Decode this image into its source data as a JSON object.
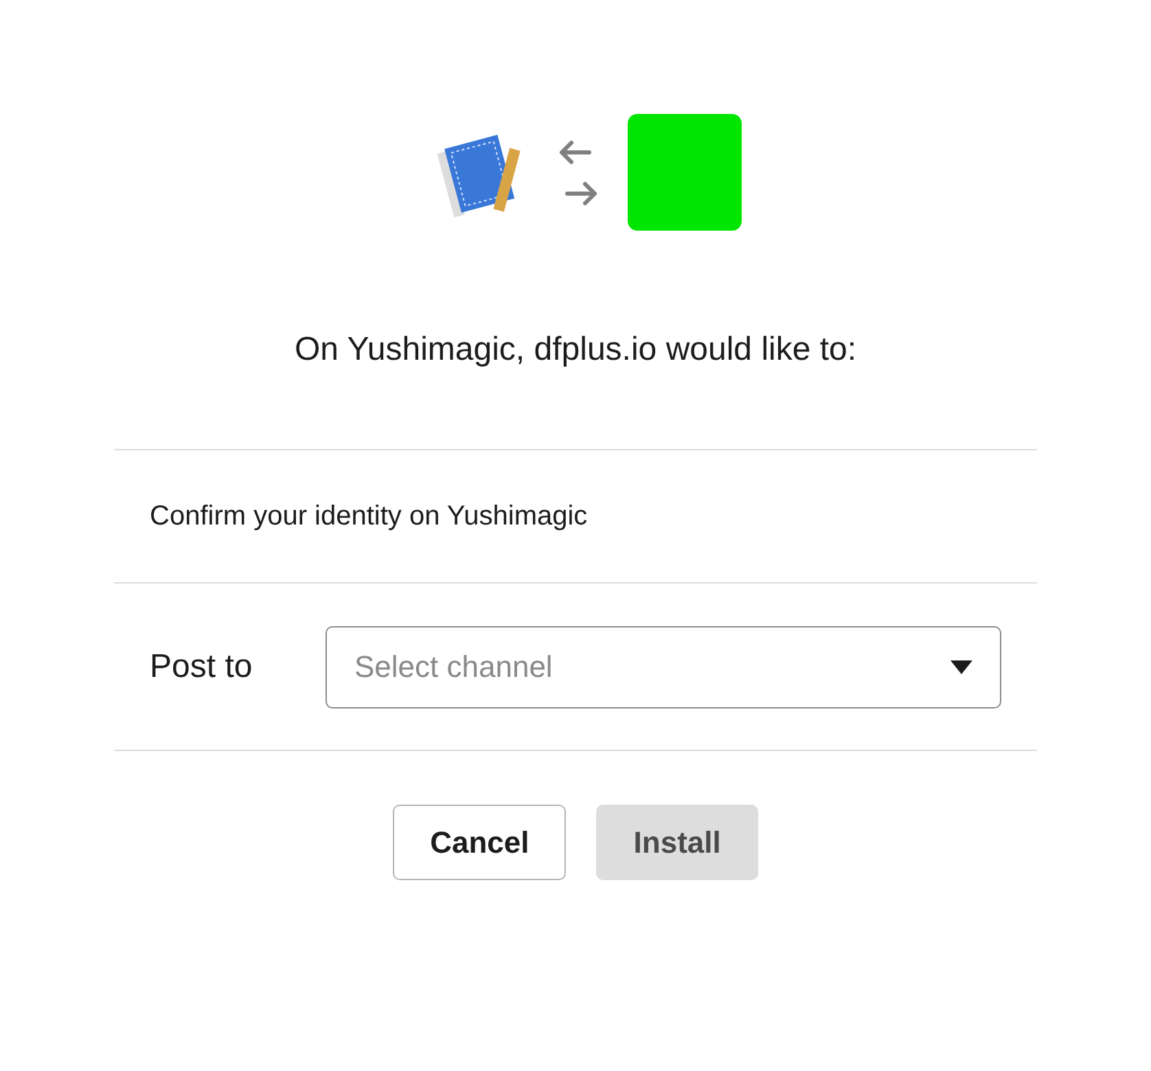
{
  "heading": "On Yushimagic, dfplus.io would like to:",
  "permissions": [
    {
      "text": "Confirm your identity on Yushimagic"
    }
  ],
  "post_to": {
    "label": "Post to",
    "placeholder": "Select channel"
  },
  "buttons": [
    {
      "label": "Cancel",
      "disabled": false
    },
    {
      "label": "Install",
      "disabled": true
    }
  ]
}
